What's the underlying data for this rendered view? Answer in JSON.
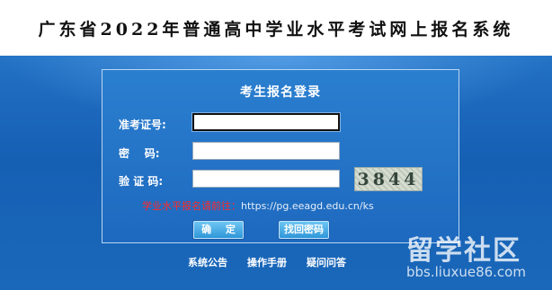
{
  "header": {
    "title": "广东省2022年普通高中学业水平考试网上报名系统"
  },
  "login": {
    "title": "考生报名登录",
    "fields": {
      "exam_id": {
        "label": "准考证号:",
        "value": ""
      },
      "password": {
        "label": "密    码:",
        "value": ""
      },
      "verify": {
        "label": "验 证 码:",
        "value": ""
      }
    },
    "captcha": "3844",
    "notice": {
      "label": "学业水平报名请前往：",
      "url": "https://pg.eeagd.edu.cn/ks"
    },
    "buttons": {
      "confirm": "确 定",
      "find_password": "找回密码"
    }
  },
  "footer": {
    "links": [
      "系统公告",
      "操作手册",
      "疑问问答"
    ]
  },
  "watermark": {
    "big": "留学社区",
    "small": "bbs.liuxue86.com"
  }
}
